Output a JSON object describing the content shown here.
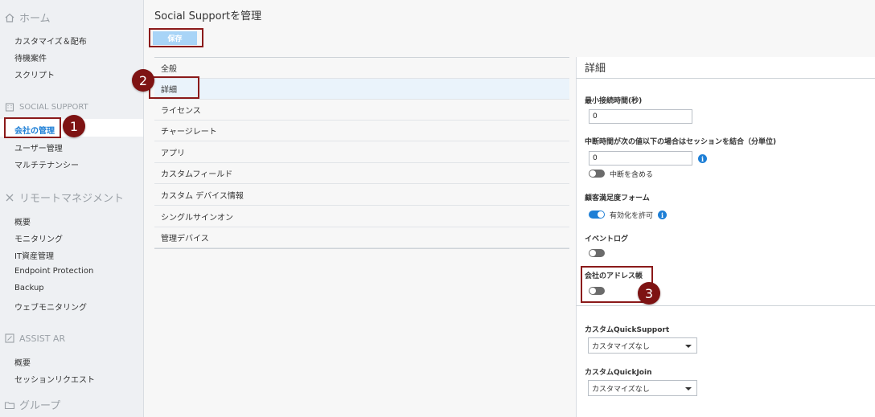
{
  "sidebar": {
    "home_label": "ホーム",
    "home_items": [
      "カスタマイズ＆配布",
      "待機案件",
      "スクリプト"
    ],
    "social_support_label": "SOCIAL SUPPORT",
    "social_items": [
      "会社の管理",
      "ユーザー管理",
      "マルチテナンシー"
    ],
    "remote_label": "リモートマネジメント",
    "remote_items": [
      "概要",
      "モニタリング",
      "IT資産管理",
      "Endpoint Protection",
      "Backup",
      "ウェブモニタリング"
    ],
    "assist_label": "ASSIST AR",
    "assist_items": [
      "概要",
      "セッションリクエスト"
    ],
    "group_label": "グループ"
  },
  "main": {
    "title": "Social Supportを管理",
    "save_label": "保存",
    "menu": [
      "全般",
      "詳細",
      "ライセンス",
      "チャージレート",
      "アプリ",
      "カスタムフィールド",
      "カスタム デバイス情報",
      "シングルサインオン",
      "管理デバイス"
    ],
    "selected_menu": "詳細"
  },
  "panel": {
    "title": "詳細",
    "min_duration_label": "最小接続時間(秒)",
    "min_duration_value": "0",
    "merge_label": "中断時間が次の値以下の場合はセッションを結合（分単位)",
    "merge_value": "0",
    "include_break_label": "中断を含める",
    "survey_label": "顧客満足度フォーム",
    "allow_enable_label": "有効化を許可",
    "event_log_label": "イベントログ",
    "address_book_label": "会社のアドレス帳",
    "custom_qs_label": "カスタムQuickSupport",
    "custom_qs_value": "カスタマイズなし",
    "custom_qj_label": "カスタムQuickJoin",
    "custom_qj_value": "カスタマイズなし"
  },
  "markers": [
    "1",
    "2",
    "3"
  ],
  "colors": {
    "accent": "#1e7fd6",
    "save_button": "#a8d4f7",
    "annotation": "#8b1a1a"
  }
}
